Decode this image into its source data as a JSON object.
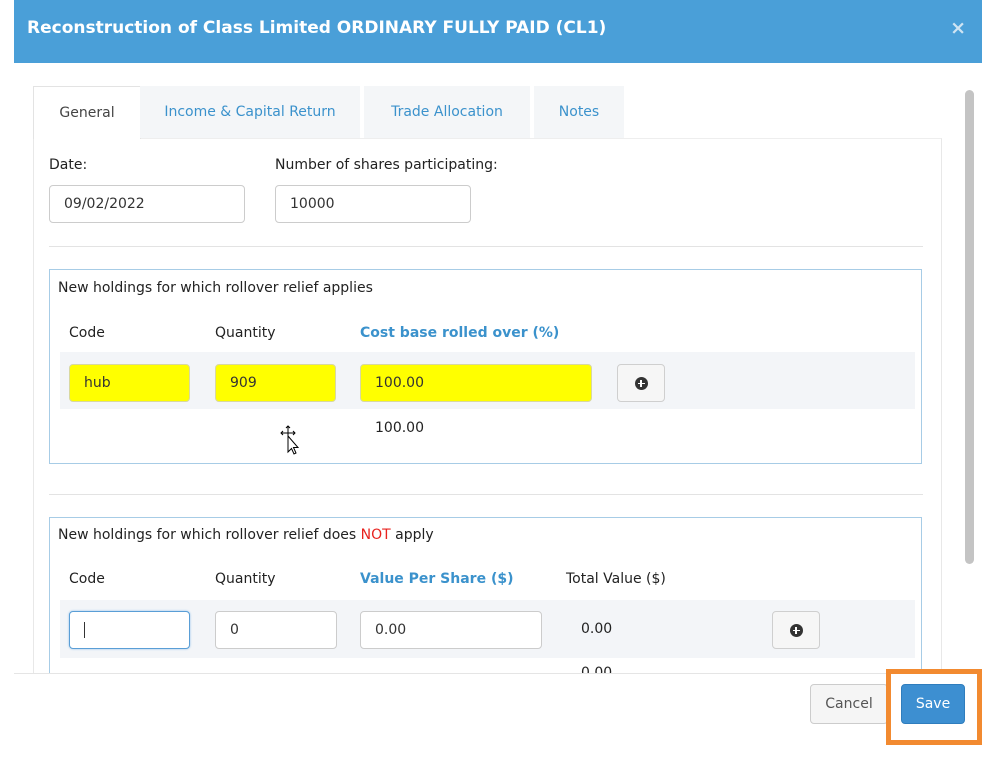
{
  "dialog": {
    "title": "Reconstruction of Class Limited ORDINARY FULLY PAID (CL1)",
    "close_symbol": "×"
  },
  "tabs": [
    {
      "label": "General",
      "active": true
    },
    {
      "label": "Income & Capital Return",
      "active": false
    },
    {
      "label": "Trade Allocation",
      "active": false
    },
    {
      "label": "Notes",
      "active": false
    }
  ],
  "general": {
    "date_label": "Date:",
    "date_value": "09/02/2022",
    "shares_label": "Number of shares participating:",
    "shares_value": "10000"
  },
  "rollover_applies": {
    "heading": "New holdings for which rollover relief applies",
    "columns": [
      "Code",
      "Quantity",
      "Cost base rolled over (%)"
    ],
    "row": {
      "code": "hub",
      "quantity": "909",
      "cost_base": "100.00"
    },
    "total": "100.00",
    "add_icon": "plus-circle-icon"
  },
  "rollover_not_applies": {
    "heading_before": "New holdings for which rollover relief does ",
    "heading_not": "NOT",
    "heading_after": " apply",
    "columns": [
      "Code",
      "Quantity",
      "Value Per Share ($)",
      "Total Value ($)"
    ],
    "row": {
      "code": "",
      "quantity": "0",
      "value_per_share": "0.00",
      "total_value": "0.00"
    },
    "total_partial": "0.00",
    "add_icon": "plus-circle-icon"
  },
  "footer": {
    "cancel_label": "Cancel",
    "save_label": "Save"
  },
  "colors": {
    "header": "#4a9fd8",
    "highlight_yellow": "#ffff00",
    "save_button": "#3d8fd1",
    "annotation_orange": "#f28a30",
    "not_red": "#e8231f"
  }
}
